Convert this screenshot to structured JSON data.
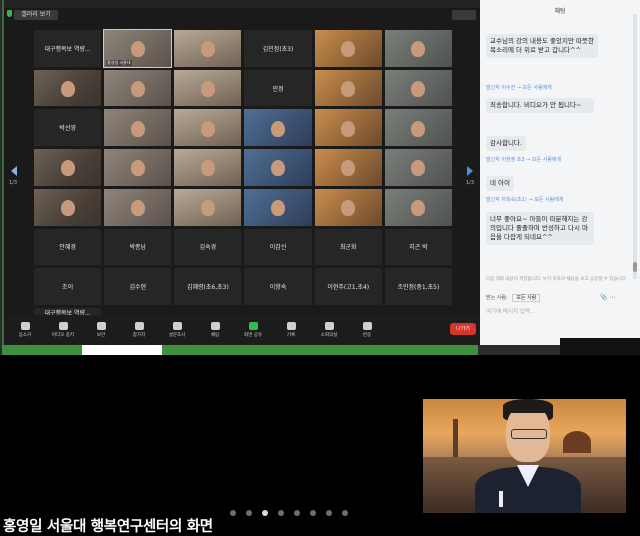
{
  "caption": "홍영일 서울대 행복연구센터의 화면",
  "zoom": {
    "view_label": "갤러리 보기",
    "tiles": [
      {
        "name": "대구행복보 역량...",
        "video": false
      },
      {
        "name": "",
        "video": true,
        "tag": "홍영일 서울대"
      },
      {
        "name": "",
        "video": true
      },
      {
        "name": "김민정(초3)",
        "video": false
      },
      {
        "name": "",
        "video": true
      },
      {
        "name": "",
        "video": true
      },
      {
        "name": "",
        "video": true
      },
      {
        "name": "",
        "video": true
      },
      {
        "name": "",
        "video": true
      },
      {
        "name": "민정",
        "video": false
      },
      {
        "name": "",
        "video": true
      },
      {
        "name": "",
        "video": true
      },
      {
        "name": "박선영",
        "video": false
      },
      {
        "name": "",
        "video": true
      },
      {
        "name": "",
        "video": true
      },
      {
        "name": "",
        "video": true
      },
      {
        "name": "",
        "video": true
      },
      {
        "name": "",
        "video": true
      },
      {
        "name": "",
        "video": true
      },
      {
        "name": "",
        "video": true
      },
      {
        "name": "",
        "video": true
      },
      {
        "name": "",
        "video": true
      },
      {
        "name": "",
        "video": true
      },
      {
        "name": "",
        "video": true
      },
      {
        "name": "",
        "video": true
      },
      {
        "name": "",
        "video": true
      },
      {
        "name": "",
        "video": true
      },
      {
        "name": "",
        "video": true
      },
      {
        "name": "",
        "video": true
      },
      {
        "name": "",
        "video": true
      },
      {
        "name": "안혜경",
        "video": false
      },
      {
        "name": "박종남",
        "video": false
      },
      {
        "name": "김숙경",
        "video": false
      },
      {
        "name": "이갑신",
        "video": false
      },
      {
        "name": "최군화",
        "video": false
      },
      {
        "name": "지곤 박",
        "video": false
      },
      {
        "name": "조이",
        "video": false
      },
      {
        "name": "김수현",
        "video": false
      },
      {
        "name": "김혜령(초6,초3)",
        "video": false
      },
      {
        "name": "이향숙",
        "video": false
      },
      {
        "name": "이현주(고1,초4)",
        "video": false
      },
      {
        "name": "조민정(중1,초5)",
        "video": false
      },
      {
        "name": "대구행복보 역량...",
        "video": false
      }
    ],
    "page_left": "1/3",
    "page_right": "1/3",
    "toolbar": [
      {
        "label": "음소거",
        "green": false
      },
      {
        "label": "비디오 중지",
        "green": false
      },
      {
        "label": "보안",
        "green": false
      },
      {
        "label": "참가자",
        "green": false
      },
      {
        "label": "설문조사",
        "green": false
      },
      {
        "label": "채팅",
        "green": false
      },
      {
        "label": "화면 공유",
        "green": true
      },
      {
        "label": "기록",
        "green": false
      },
      {
        "label": "소회의실",
        "green": false
      },
      {
        "label": "반응",
        "green": false
      }
    ],
    "end_label": "나가기"
  },
  "chat": {
    "title": "채팅",
    "messages": [
      {
        "kind": "msg",
        "text": "교수님의 강의 내용도 좋았지만 따뜻한 목소리에 더 위로 받고 갑니다^^"
      },
      {
        "kind": "meta",
        "text": "발신자 이수진 → 모든 사람에게"
      },
      {
        "kind": "msg",
        "text": "죄송합니다. 비디오가 안 됩니다~"
      },
      {
        "kind": "msg",
        "text": "감사합니다."
      },
      {
        "kind": "meta",
        "text": "발신자 이현정 초3 → 모든 사람에게"
      },
      {
        "kind": "msg",
        "text": "네 아이"
      },
      {
        "kind": "meta",
        "text": "발신자 차희숙(초1) → 모든 사람에게"
      },
      {
        "kind": "msg",
        "text": "너무 좋아요~ 아들이 따분해지는 강의입니다 졸졸하며 반성하고 다시 마음을 다잡게 되네요^^"
      }
    ],
    "hint": "다음 대화 내용이 저장됩니다. 누가 귀하의 채팅을 보고 공유할 수 있습니다",
    "to_label": "받는 사람:",
    "to_value": "모든 사람",
    "input_placeholder": "여기에 메시지 입력...",
    "file_icon": "📎",
    "more_icon": "⋯"
  },
  "dots": {
    "count": 8,
    "active": 2
  }
}
